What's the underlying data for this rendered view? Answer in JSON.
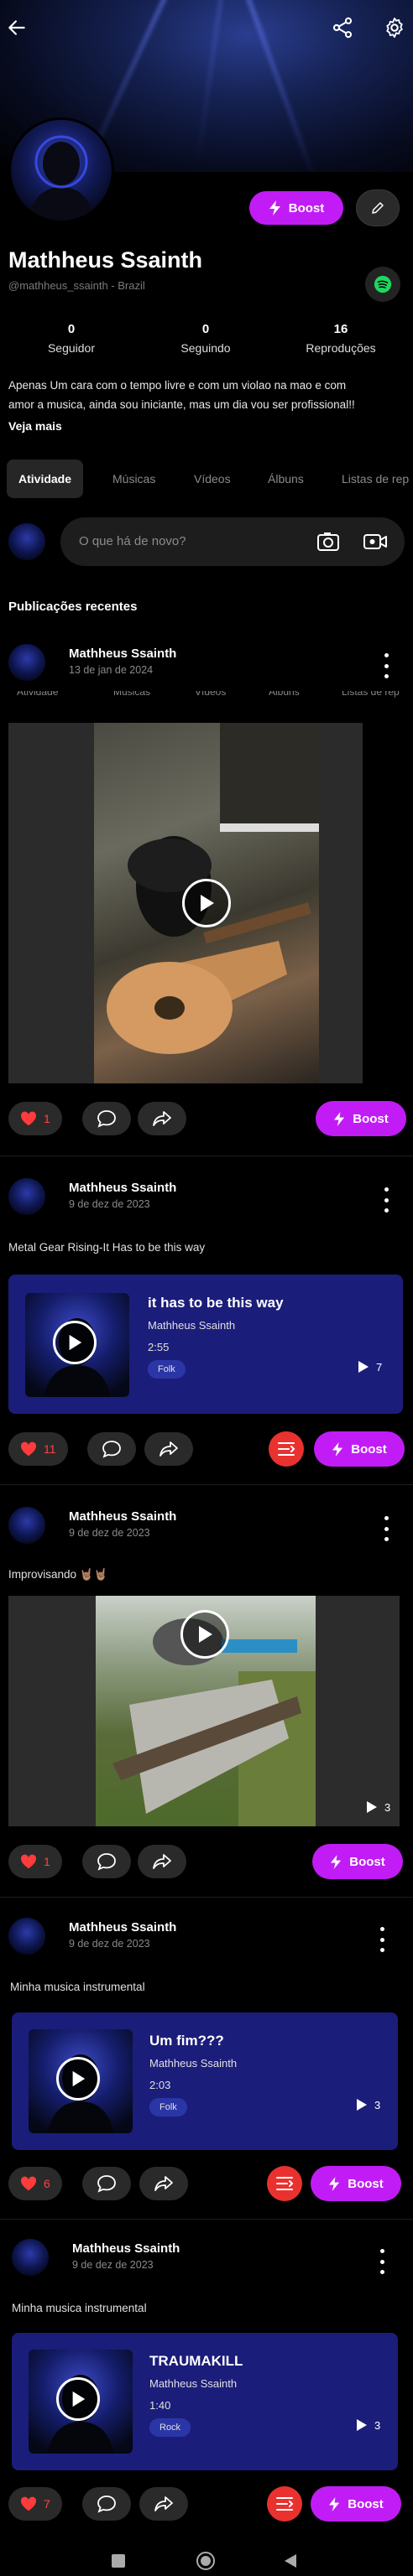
{
  "profile": {
    "name": "Mathheus Ssainth",
    "handle": "@mathheus_ssainth - Brazil",
    "boost_label": "Boost",
    "stats": [
      {
        "value": "0",
        "label": "Seguidor"
      },
      {
        "value": "0",
        "label": "Seguindo"
      },
      {
        "value": "16",
        "label": "Reproduções"
      }
    ],
    "bio_line1": "Apenas Um cara com o tempo livre e com um violao na mao e com",
    "bio_line2": "amor a musica, ainda sou iniciante, mas um dia vou ser profissional!!",
    "see_more": "Veja mais"
  },
  "tabs": [
    "Atividade",
    "Músicas",
    "Vídeos",
    "Álbuns",
    "Listas de rep"
  ],
  "compose": {
    "placeholder": "O que há de novo?"
  },
  "section_title": "Publicações recentes",
  "colors": {
    "accent": "#c11cf5",
    "like": "#ff3b3b",
    "card": "#1b1d7a",
    "queue": "#e9322f"
  },
  "posts": [
    {
      "author": "Mathheus Ssainth",
      "date": "13 de jan de 2024",
      "likes": "1",
      "boost": "Boost",
      "ghost_tabs": [
        "Atividade",
        "Músicas",
        "Vídeos",
        "Álbuns",
        "Listas de rep"
      ]
    },
    {
      "author": "Mathheus Ssainth",
      "date": "9 de dez de 2023",
      "text": "Metal Gear Rising-It Has to be this way",
      "likes": "11",
      "boost": "Boost",
      "track": {
        "title": "it has to be this way",
        "artist": "Mathheus Ssainth",
        "duration": "2:55",
        "genre": "Folk",
        "plays": "7"
      }
    },
    {
      "author": "Mathheus Ssainth",
      "date": "9 de dez de 2023",
      "text": "Improvisando 🤘🏽🤘🏽",
      "likes": "1",
      "boost": "Boost",
      "plays": "3"
    },
    {
      "author": "Mathheus Ssainth",
      "date": "9 de dez de 2023",
      "text": "Minha musica instrumental",
      "likes": "6",
      "boost": "Boost",
      "track": {
        "title": "Um fim???",
        "artist": "Mathheus Ssainth",
        "duration": "2:03",
        "genre": "Folk",
        "plays": "3"
      }
    },
    {
      "author": "Mathheus Ssainth",
      "date": "9 de dez de 2023",
      "text": "Minha musica instrumental",
      "likes": "7",
      "boost": "Boost",
      "track": {
        "title": "TRAUMAKILL",
        "artist": "Mathheus Ssainth",
        "duration": "1:40",
        "genre": "Rock",
        "plays": "3"
      }
    }
  ]
}
